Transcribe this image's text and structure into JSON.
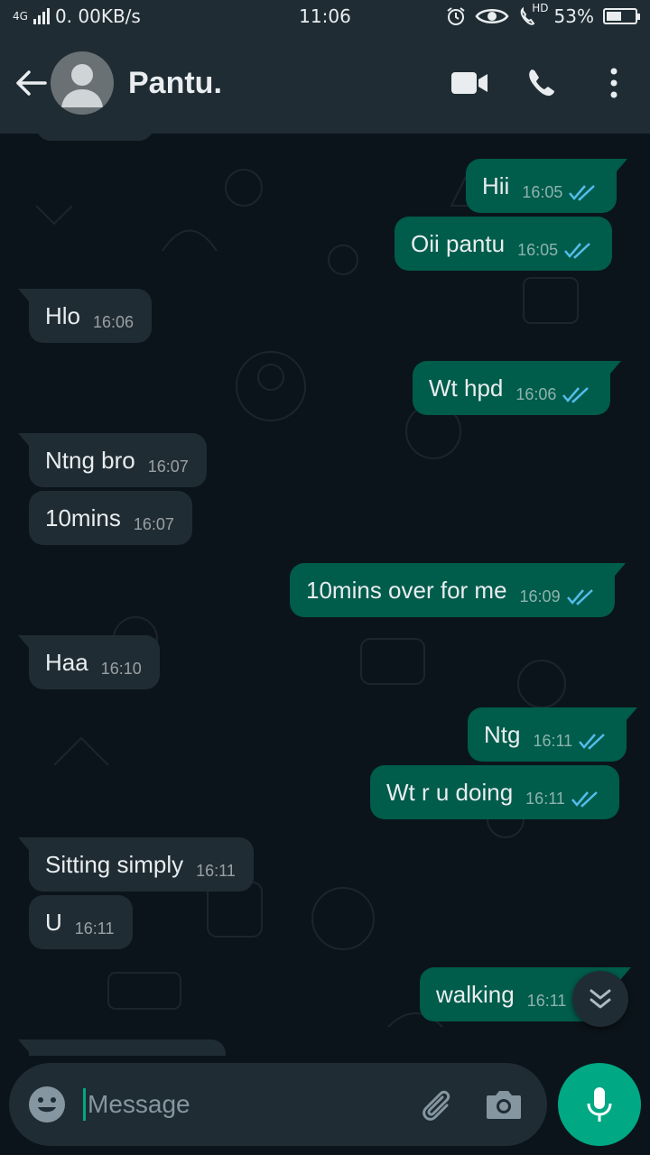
{
  "status_bar": {
    "network": "4G",
    "speed": "0. 00KB/s",
    "time": "11:06",
    "hd": "HD",
    "battery": "53%",
    "battery_level": 0.53
  },
  "header": {
    "contact_name": "Pantu."
  },
  "messages": [
    {
      "text": "Hii",
      "time": "16:05",
      "dir": "out"
    },
    {
      "text": "Oii pantu",
      "time": "16:05",
      "dir": "out"
    },
    {
      "text": "Hlo",
      "time": "16:06",
      "dir": "in"
    },
    {
      "text": "Wt hpd",
      "time": "16:06",
      "dir": "out"
    },
    {
      "text": "Ntng bro",
      "time": "16:07",
      "dir": "in"
    },
    {
      "text": "10mins",
      "time": "16:07",
      "dir": "in"
    },
    {
      "text": "10mins over for me",
      "time": "16:09",
      "dir": "out"
    },
    {
      "text": "Haa",
      "time": "16:10",
      "dir": "in"
    },
    {
      "text": "Ntg",
      "time": "16:11",
      "dir": "out"
    },
    {
      "text": "Wt r u doing",
      "time": "16:11",
      "dir": "out"
    },
    {
      "text": "Sitting simply",
      "time": "16:11",
      "dir": "in"
    },
    {
      "text": "U",
      "time": "16:11",
      "dir": "in"
    },
    {
      "text": "walking",
      "time": "16:11",
      "dir": "out"
    }
  ],
  "composer": {
    "placeholder": "Message"
  },
  "colors": {
    "incoming": "#202c33",
    "outgoing": "#005c4b",
    "read_ticks": "#53bdeb",
    "accent": "#00a884"
  },
  "icons": [
    "back-arrow-icon",
    "video-call-icon",
    "phone-icon",
    "more-options-icon",
    "emoji-icon",
    "attach-icon",
    "camera-icon",
    "mic-icon",
    "scroll-down-icon",
    "double-tick-icon"
  ]
}
